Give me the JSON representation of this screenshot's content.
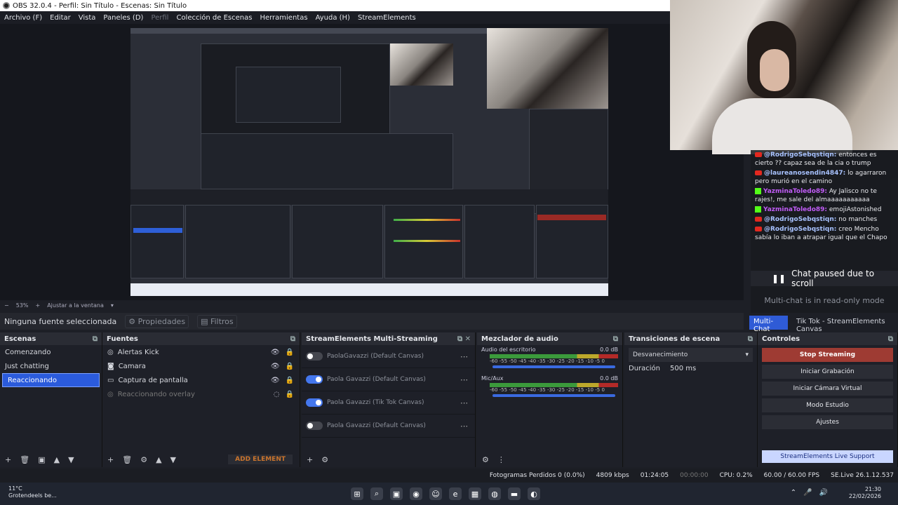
{
  "window": {
    "title": "OBS 32.0.4 - Perfil: Sin Título - Escenas: Sin Título"
  },
  "menu": [
    "Archivo (F)",
    "Editar",
    "Vista",
    "Paneles (D)",
    "Perfil",
    "Colección de Escenas",
    "Herramientas",
    "Ayuda (H)",
    "StreamElements"
  ],
  "preview": {
    "zoom": "53%",
    "fit": "Ajustar a la ventana"
  },
  "source_bar": {
    "none": "Ninguna fuente seleccionada",
    "props": "Propiedades",
    "filters": "Filtros"
  },
  "chat": {
    "messages": [
      {
        "user": "@RodrigoSebqstiqn:",
        "text": "entonces es cierto ?? capaz sea de la cia o trump",
        "platform": "yt"
      },
      {
        "user": "@laureanosendin4847:",
        "text": "lo agarraron pero murió en el camino",
        "platform": "yt"
      },
      {
        "user": "YazminaToledo89:",
        "text": "Ay Jalisco no te rajes!, me sale del almaaaaaaaaaaa",
        "platform": "kick"
      },
      {
        "user": "YazminaToledo89:",
        "text": "emojiAstonished",
        "platform": "kick"
      },
      {
        "user": "@RodrigoSebqstiqn:",
        "text": "no manches",
        "platform": "yt"
      },
      {
        "user": "@RodrigoSebqstiqn:",
        "text": "creo Mencho sabía lo iban a atrapar igual que el Chapo",
        "platform": "yt"
      }
    ],
    "paused": "Chat paused due to scroll",
    "readonly": "Multi-chat is in read-only mode"
  },
  "chat_tabs": [
    "Multi-Chat",
    "Tik Tok - StreamElements Canvas"
  ],
  "scenes": {
    "title": "Escenas",
    "items": [
      "Comenzando",
      "Just chatting",
      "Reaccionando"
    ],
    "selected": 2
  },
  "sources": {
    "title": "Fuentes",
    "items": [
      "Alertas Kick",
      "Camara",
      "Captura de pantalla",
      "Reaccionando overlay"
    ],
    "add": "ADD ELEMENT"
  },
  "multistream": {
    "title": "StreamElements Multi-Streaming",
    "rows": [
      {
        "name": "PaolaGavazzi (Default Canvas)",
        "on": false
      },
      {
        "name": "Paola Gavazzi (Default Canvas)",
        "on": true
      },
      {
        "name": "Paola Gavazzi (Tik Tok Canvas)",
        "on": true
      },
      {
        "name": "Paola Gavazzi (Default Canvas)",
        "on": false
      }
    ]
  },
  "mixer": {
    "title": "Mezclador de audio",
    "channels": [
      {
        "name": "Audio del escritorio",
        "db": "0.0 dB",
        "scale": "-60 -55 -50 -45 -40 -35 -30 -25 -20 -15 -10 -5 0"
      },
      {
        "name": "Mic/Aux",
        "db": "0.0 dB",
        "scale": "-60 -55 -50 -45 -40 -35 -30 -25 -20 -15 -10 -5 0"
      }
    ]
  },
  "transitions": {
    "title": "Transiciones de escena",
    "selected": "Desvanecimiento",
    "duration_label": "Duración",
    "duration": "500 ms"
  },
  "controls": {
    "title": "Controles",
    "buttons": [
      "Stop Streaming",
      "Iniciar Grabación",
      "Iniciar Cámara Virtual",
      "Modo Estudio",
      "Ajustes"
    ],
    "support": "StreamElements Live Support"
  },
  "status": {
    "frames": "Fotogramas Perdidos 0 (0.0%)",
    "kbps": "4809 kbps",
    "live": "01:24:05",
    "rec": "00:00:00",
    "cpu": "CPU: 0.2%",
    "fps": "60.00 / 60.00 FPS",
    "version": "SE.Live 26.1.12.537"
  },
  "taskbar": {
    "temp": "11°C",
    "weather": "Grotendeels be...",
    "time": "21:30",
    "date": "22/02/2026"
  },
  "colors": {
    "accent": "#2b5bdc",
    "stop": "#9e3b33"
  }
}
